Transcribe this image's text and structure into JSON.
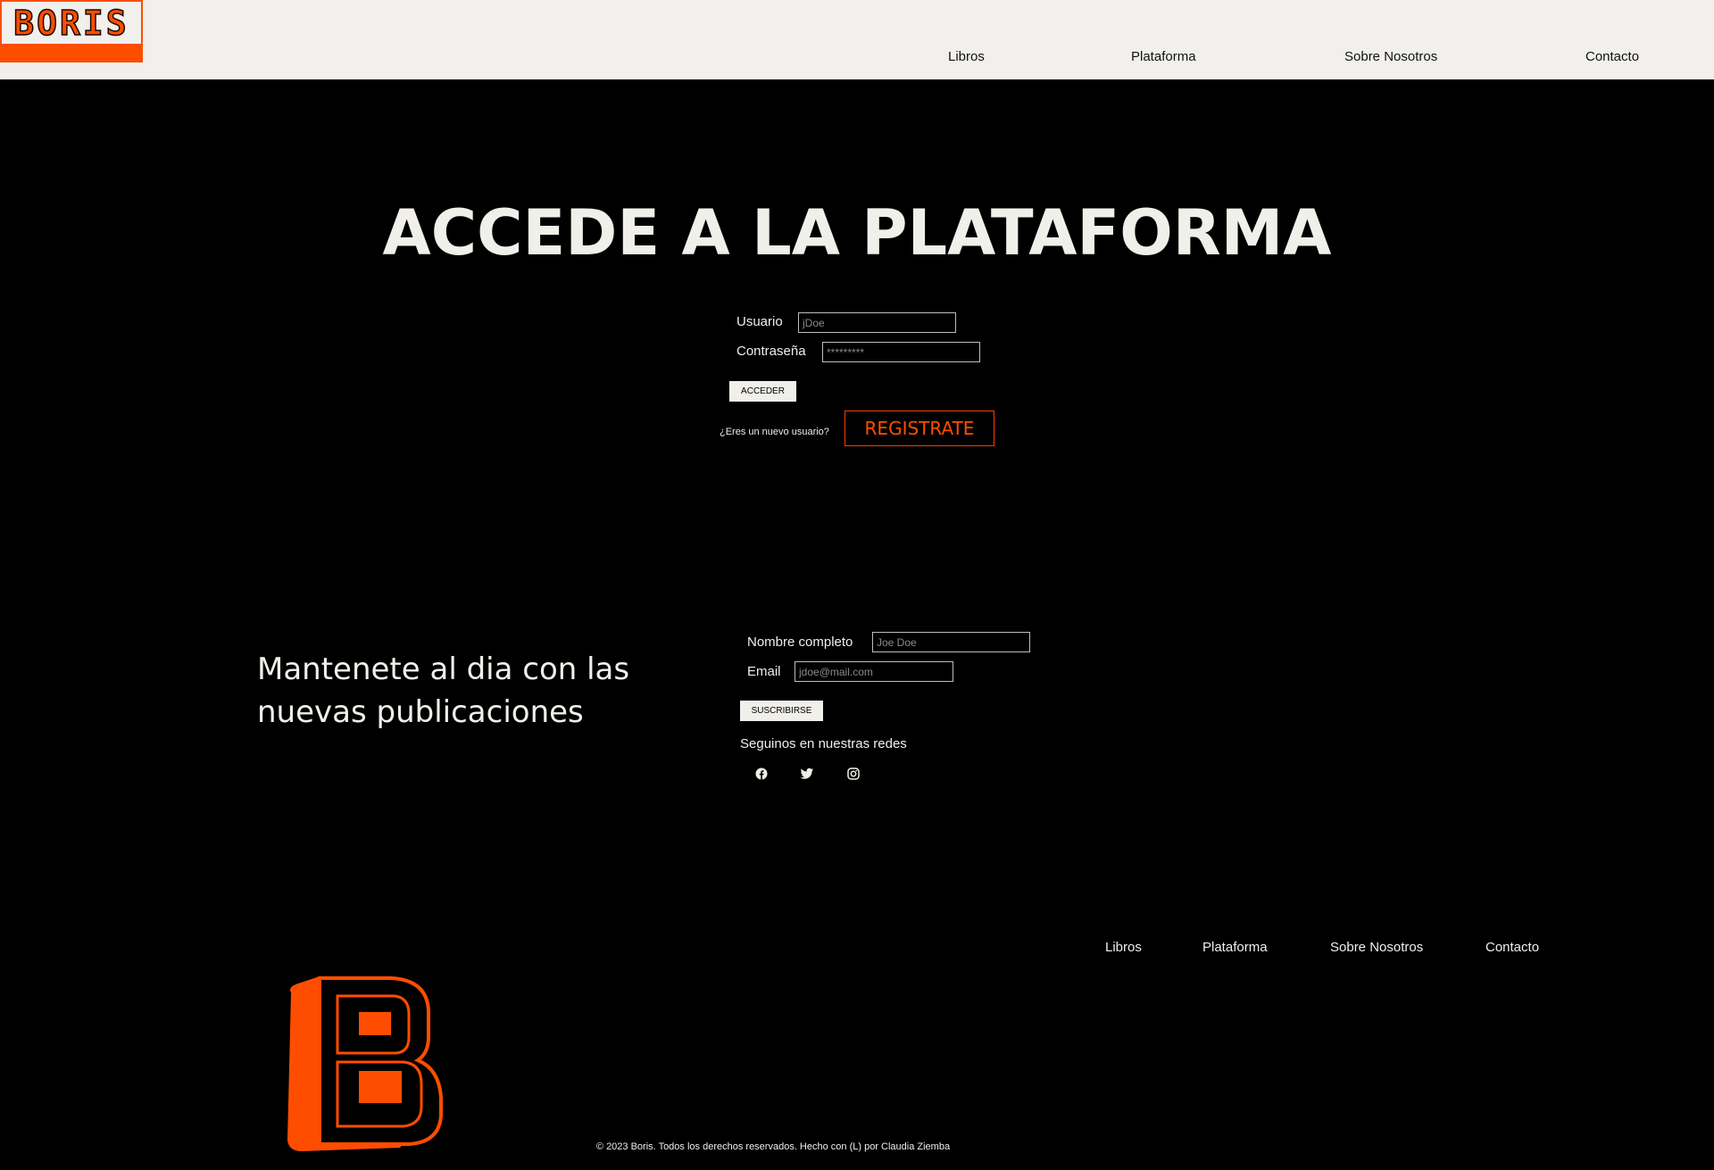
{
  "brand": {
    "logo_text": "BORIS",
    "accent": "#ff4d00"
  },
  "nav": {
    "libros": "Libros",
    "plataforma": "Plataforma",
    "sobre": "Sobre Nosotros",
    "contacto": "Contacto"
  },
  "login": {
    "title": "ACCEDE A LA PLATAFORMA",
    "user_label": "Usuario",
    "user_placeholder": "jDoe",
    "pass_label": "Contraseña",
    "pass_placeholder": "*********",
    "submit_label": "ACCEDER",
    "new_user_text": "¿Eres un nuevo usuario?",
    "register_label": "REGISTRATE"
  },
  "newsletter": {
    "title": "Mantenete al dia con las nuevas publicaciones",
    "name_label": "Nombre completo",
    "name_placeholder": "Joe Doe",
    "email_label": "Email",
    "email_placeholder": "jdoe@mail.com",
    "submit_label": "SUSCRIBIRSE",
    "follow_text": "Seguinos en nuestras redes",
    "social_icons": [
      "facebook-icon",
      "twitter-icon",
      "instagram-icon"
    ]
  },
  "footer": {
    "nav": {
      "libros": "Libros",
      "plataforma": "Plataforma",
      "sobre": "Sobre Nosotros",
      "contacto": "Contacto"
    },
    "copyright": "© 2023 Boris. Todos los derechos reservados. Hecho con (L) por Claudia Ziemba"
  }
}
